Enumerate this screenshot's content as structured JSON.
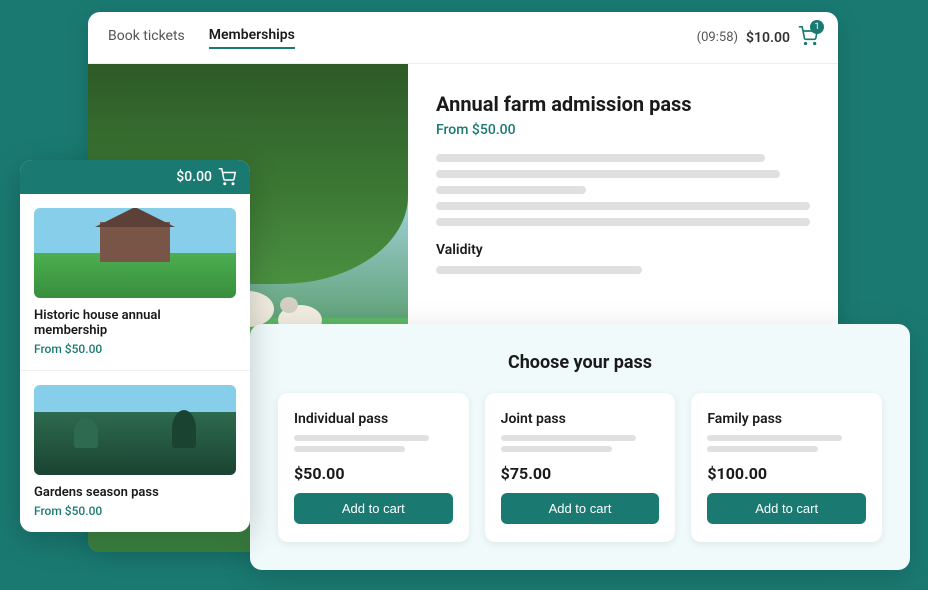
{
  "nav": {
    "tab_book": "Book tickets",
    "tab_memberships": "Memberships",
    "timer": "(09:58)",
    "price": "$10.00",
    "cart_badge": "1"
  },
  "product": {
    "title": "Annual farm admission pass",
    "price": "From $50.00",
    "validity_label": "Validity"
  },
  "pass_modal": {
    "title": "Choose your pass",
    "cards": [
      {
        "name": "Individual pass",
        "price": "$50.00",
        "btn": "Add to cart"
      },
      {
        "name": "Joint pass",
        "price": "$75.00",
        "btn": "Add to cart"
      },
      {
        "name": "Family pass",
        "price": "$100.00",
        "btn": "Add to cart"
      }
    ]
  },
  "floating_card": {
    "header_price": "$0.00",
    "items": [
      {
        "name": "Historic house annual membership",
        "price": "From $50.00",
        "img_type": "house"
      },
      {
        "name": "Gardens season pass",
        "price": "From $50.00",
        "img_type": "garden"
      }
    ]
  }
}
